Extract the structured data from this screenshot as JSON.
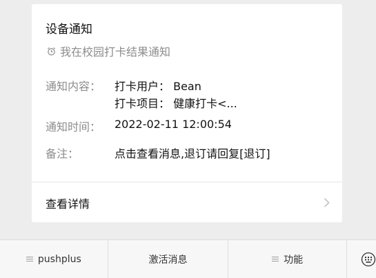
{
  "card": {
    "title": "设备通知",
    "subtitle": "我在校园打卡结果通知",
    "subtitle_icon": "alarm-clock-icon",
    "content_label": "通知内容：",
    "content_line1": "打卡用户： Bean",
    "content_line2": "打卡项目： 健康打卡<...",
    "time_label": "通知时间：",
    "time_value": "2022-02-11 12:00:54",
    "note_label": "备注：",
    "note_value": "点击查看消息,退订请回复[退订]",
    "details_label": "查看详情",
    "details_icon": "chevron-right-icon"
  },
  "menu": {
    "items": [
      {
        "label": "pushplus",
        "icon": "menu-lines-icon"
      },
      {
        "label": "激活消息"
      },
      {
        "label": "功能",
        "icon": "menu-lines-icon"
      }
    ],
    "keyboard_icon": "keyboard-icon"
  },
  "colors": {
    "background": "#ededed",
    "card": "#ffffff",
    "muted_text": "#8c8c8c",
    "primary_text": "#111111"
  }
}
